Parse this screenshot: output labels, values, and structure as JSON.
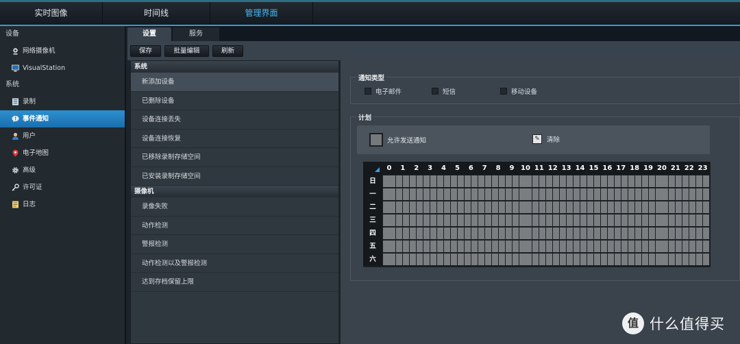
{
  "topnav": {
    "tabs": [
      "实时图像",
      "时间线",
      "管理界面"
    ],
    "active_index": 2
  },
  "sidebar": {
    "sections": [
      {
        "label": "设备",
        "items": [
          {
            "label": "网络摄像机",
            "icon": "camera-icon"
          },
          {
            "label": "VisualStation",
            "icon": "monitor-icon"
          }
        ]
      },
      {
        "label": "系统",
        "items": [
          {
            "label": "录制",
            "icon": "recording-icon"
          },
          {
            "label": "事件通知",
            "icon": "notification-icon",
            "active": true
          },
          {
            "label": "用户",
            "icon": "user-icon"
          },
          {
            "label": "电子地图",
            "icon": "map-pin-icon"
          },
          {
            "label": "高级",
            "icon": "gear-icon"
          },
          {
            "label": "许可证",
            "icon": "key-icon"
          },
          {
            "label": "日志",
            "icon": "log-icon"
          }
        ]
      }
    ]
  },
  "tabs": {
    "settings": "设置",
    "service": "服务"
  },
  "toolbar": {
    "save": "保存",
    "batch_edit": "批量编辑",
    "refresh": "刷新"
  },
  "event_list": {
    "system_header": "系统",
    "system_items": [
      "新添加设备",
      "已删除设备",
      "设备连接丢失",
      "设备连接恢复",
      "已移除录制存储空间",
      "已安装录制存储空间"
    ],
    "camera_header": "摄像机",
    "camera_items": [
      "录像失败",
      "动作检测",
      "警报检测",
      "动作检测以及警报检测",
      "达到存档保留上限"
    ],
    "selected": "新添加设备"
  },
  "notification_type": {
    "title": "通知类型",
    "options": [
      {
        "label": "电子邮件",
        "checked": false
      },
      {
        "label": "短信",
        "checked": false
      },
      {
        "label": "移动设备",
        "checked": false
      }
    ]
  },
  "schedule": {
    "title": "计划",
    "allow_label": "允许发送通知",
    "clear_label": "清除",
    "hours": [
      "0",
      "1",
      "2",
      "3",
      "4",
      "5",
      "6",
      "7",
      "8",
      "9",
      "10",
      "11",
      "12",
      "13",
      "14",
      "15",
      "16",
      "17",
      "18",
      "19",
      "20",
      "21",
      "22",
      "23"
    ],
    "days": [
      "日",
      "一",
      "二",
      "三",
      "四",
      "五",
      "六"
    ]
  },
  "watermark": {
    "text": "什么值得买"
  },
  "colors": {
    "accent": "#2f9fd8",
    "active_item": "#2d8fd0",
    "grid_cell": "#7b7e81"
  }
}
